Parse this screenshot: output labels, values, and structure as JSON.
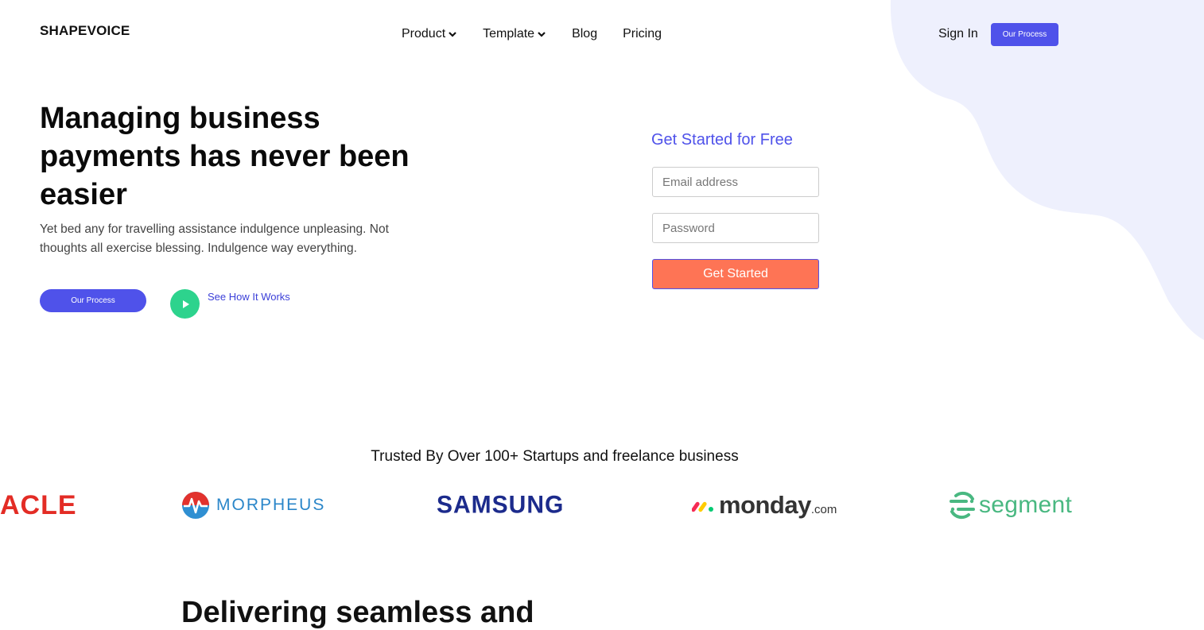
{
  "header": {
    "logo": "SHAPEVOICE",
    "nav": [
      {
        "label": "Product",
        "has_dropdown": true
      },
      {
        "label": "Template",
        "has_dropdown": true
      },
      {
        "label": "Blog",
        "has_dropdown": false
      },
      {
        "label": "Pricing",
        "has_dropdown": false
      }
    ],
    "sign_in": "Sign In",
    "cta": "Our Process"
  },
  "hero": {
    "title": "Managing business payments has never been easier",
    "subtitle": "Yet bed any for travelling assistance indulgence unpleasing. Not thoughts all exercise blessing. Indulgence way everything.",
    "primary_button": "Our Process",
    "secondary_link": "See How It Works"
  },
  "signup": {
    "title": "Get Started for Free",
    "email_placeholder": "Email address",
    "password_placeholder": "Password",
    "submit": "Get Started"
  },
  "trusted": {
    "heading": "Trusted By Over 100+ Startups and freelance business",
    "logos": {
      "oracle": "ACLE",
      "morpheus": "MORPHEUS",
      "samsung": "SAMSUNG",
      "monday": "monday",
      "monday_suffix": ".com",
      "segment": "segment"
    }
  },
  "next_section": {
    "heading_partial": "Delivering seamless and"
  },
  "colors": {
    "accent": "#4f52ea",
    "cta_orange": "#fe7455",
    "play_green": "#2dd38d",
    "blob": "#eef0fd"
  }
}
